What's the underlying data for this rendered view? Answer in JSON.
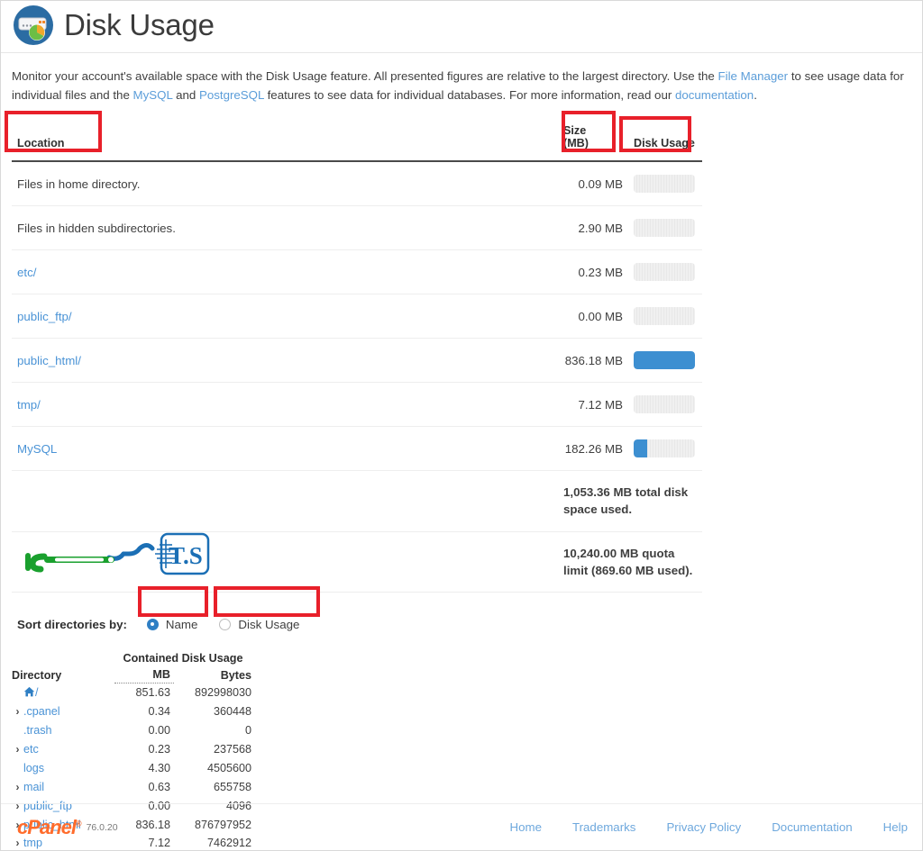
{
  "header": {
    "title": "Disk Usage",
    "icon": "disk-usage-icon"
  },
  "description": {
    "part1": "Monitor your account's available space with the Disk Usage feature. All presented figures are relative to the largest directory. Use the ",
    "link_file_manager": "File Manager",
    "part2": " to see usage data for individual files and the ",
    "link_mysql": "MySQL",
    "part3": " and ",
    "link_postgresql": "PostgreSQL",
    "part4": " features to see data for individual databases. For more information, read our ",
    "link_documentation": "documentation",
    "part5": "."
  },
  "table": {
    "headers": {
      "location": "Location",
      "size": "Size (MB)",
      "size_line1": "Size",
      "size_line2": "(MB)",
      "disk_usage": "Disk Usage"
    },
    "rows": [
      {
        "location": "Files in home directory.",
        "is_link": false,
        "size": "0.09 MB",
        "size_value": 0.09,
        "bar_percent": 0
      },
      {
        "location": "Files in hidden subdirectories.",
        "is_link": false,
        "size": "2.90 MB",
        "size_value": 2.9,
        "bar_percent": 0
      },
      {
        "location": "etc/",
        "is_link": true,
        "size": "0.23 MB",
        "size_value": 0.23,
        "bar_percent": 0
      },
      {
        "location": "public_ftp/",
        "is_link": true,
        "size": "0.00 MB",
        "size_value": 0.0,
        "bar_percent": 0
      },
      {
        "location": "public_html/",
        "is_link": true,
        "size": "836.18 MB",
        "size_value": 836.18,
        "bar_percent": 100
      },
      {
        "location": "tmp/",
        "is_link": true,
        "size": "7.12 MB",
        "size_value": 7.12,
        "bar_percent": 0
      },
      {
        "location": "MySQL",
        "is_link": true,
        "size": "182.26 MB",
        "size_value": 182.26,
        "bar_percent": 22
      }
    ],
    "summary": {
      "total": "1,053.36 MB total disk space used.",
      "quota": "10,240.00 MB quota limit (869.60 MB used)."
    }
  },
  "sort": {
    "label": "Sort directories by:",
    "options": [
      {
        "label": "Name",
        "selected": true
      },
      {
        "label": "Disk Usage",
        "selected": false
      }
    ]
  },
  "tree": {
    "headers": {
      "directory": "Directory",
      "contained": "Contained Disk Usage",
      "mb": "MB",
      "bytes": "Bytes"
    },
    "rows": [
      {
        "name": "/",
        "is_home": true,
        "expandable": false,
        "mb": "851.63",
        "bytes": "892998030"
      },
      {
        "name": ".cpanel",
        "is_home": false,
        "expandable": true,
        "mb": "0.34",
        "bytes": "360448"
      },
      {
        "name": ".trash",
        "is_home": false,
        "expandable": false,
        "mb": "0.00",
        "bytes": "0"
      },
      {
        "name": "etc",
        "is_home": false,
        "expandable": true,
        "mb": "0.23",
        "bytes": "237568"
      },
      {
        "name": "logs",
        "is_home": false,
        "expandable": false,
        "mb": "4.30",
        "bytes": "4505600"
      },
      {
        "name": "mail",
        "is_home": false,
        "expandable": true,
        "mb": "0.63",
        "bytes": "655758"
      },
      {
        "name": "public_ftp",
        "is_home": false,
        "expandable": true,
        "mb": "0.00",
        "bytes": "4096"
      },
      {
        "name": "public_html",
        "is_home": false,
        "expandable": true,
        "mb": "836.18",
        "bytes": "876797952"
      },
      {
        "name": "tmp",
        "is_home": false,
        "expandable": true,
        "mb": "7.12",
        "bytes": "7462912"
      }
    ]
  },
  "footer": {
    "brand": "cPanel",
    "version": "76.0.20",
    "links": [
      "Home",
      "Trademarks",
      "Privacy Policy",
      "Documentation",
      "Help"
    ]
  },
  "watermark": {
    "text_box": "T.S",
    "alt": "tehran-server-watermark"
  },
  "colors": {
    "accent_blue": "#3d8fd1",
    "link_blue": "#4a93d6",
    "annotation_red": "#e8202a",
    "cpanel_orange": "#ff6c2c"
  }
}
